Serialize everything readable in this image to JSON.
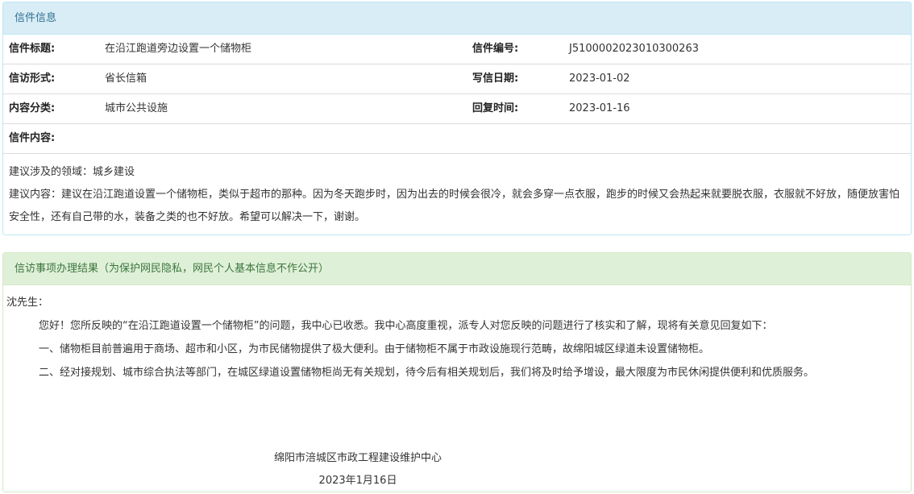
{
  "letter_info": {
    "heading": "信件信息",
    "title_label": "信件标题:",
    "title_value": "在沿江跑道旁边设置一个储物柜",
    "number_label": "信件编号:",
    "number_value": "J5100002023010300263",
    "form_label": "信访形式:",
    "form_value": "省长信箱",
    "date_label": "写信日期:",
    "date_value": "2023-01-02",
    "category_label": "内容分类:",
    "category_value": "城市公共设施",
    "reply_time_label": "回复时间:",
    "reply_time_value": "2023-01-16",
    "content_label": "信件内容:",
    "content_line1": "建议涉及的领域：城乡建设",
    "content_line2": "建议内容：建议在沿江跑道设置一个储物柜，类似于超市的那种。因为冬天跑步时，因为出去的时候会很冷，就会多穿一点衣服，跑步的时候又会热起来就要脱衣服，衣服就不好放，随便放害怕安全性，还有自己带的水，装备之类的也不好放。希望可以解决一下，谢谢。"
  },
  "result": {
    "heading": "信访事项办理结果（为保护网民隐私，网民个人基本信息不作公开）",
    "salutation": "沈先生：",
    "para1": "您好！您所反映的“在沿江跑道设置一个储物柜”的问题，我中心已收悉。我中心高度重视，派专人对您反映的问题进行了核实和了解，现将有关意见回复如下：",
    "para2": "一、储物柜目前普遍用于商场、超市和小区，为市民储物提供了极大便利。由于储物柜不属于市政设施现行范畴，故绵阳城区绿道未设置储物柜。",
    "para3": "二、经对接规划、城市综合执法等部门，在城区绿道设置储物柜尚无有关规划，待今后有相关规划后，我们将及时给予增设，最大限度为市民休闲提供便利和优质服务。",
    "signature": "绵阳市涪城区市政工程建设维护中心",
    "sign_date": "2023年1月16日"
  }
}
